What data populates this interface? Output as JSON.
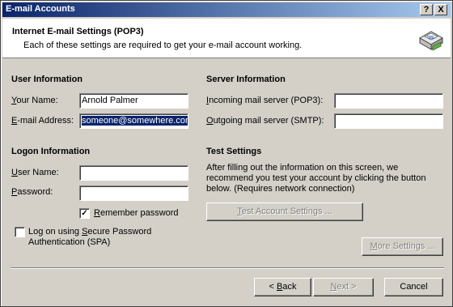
{
  "window": {
    "title": "E-mail Accounts",
    "help_label": "?",
    "close_label": "X"
  },
  "header": {
    "title": "Internet E-mail Settings (POP3)",
    "subtitle": "Each of these settings are required to get your e-mail account working."
  },
  "user_info": {
    "heading": "User Information",
    "name_label_u": "Y",
    "name_label_rest": "our Name:",
    "name_value": "Arnold Palmer",
    "email_label_u": "E",
    "email_label_rest": "-mail Address:",
    "email_value": "someone@somewhere.com"
  },
  "server_info": {
    "heading": "Server Information",
    "incoming_label_u": "I",
    "incoming_label_rest": "ncoming mail server (POP3):",
    "incoming_value": "",
    "outgoing_label_u": "O",
    "outgoing_label_rest": "utgoing mail server (SMTP):",
    "outgoing_value": ""
  },
  "logon_info": {
    "heading": "Logon Information",
    "username_label_u": "U",
    "username_label_rest": "ser Name:",
    "username_value": "",
    "password_label_u": "P",
    "password_label_rest": "assword:",
    "password_value": "",
    "remember_label_u": "R",
    "remember_label_rest": "emember password",
    "remember_checked": true,
    "spa_label_pre": "Log on using ",
    "spa_label_u": "S",
    "spa_label_rest": "ecure Password",
    "spa_label_line2": "Authentication (SPA)",
    "spa_checked": false
  },
  "test_settings": {
    "heading": "Test Settings",
    "line1": "After filling out the information on this screen, we",
    "line2": "recommend you test your account by clicking the button",
    "line3": "below. (Requires network connection)",
    "button_label_u": "T",
    "button_label_rest": "est Account Settings ..."
  },
  "more_settings": {
    "label_u": "M",
    "label_rest": "ore Settings ..."
  },
  "footer": {
    "back_lt": "< ",
    "back_u": "B",
    "back_rest": "ack",
    "next_u": "N",
    "next_rest": "ext >",
    "cancel_label": "Cancel"
  },
  "check_glyph": "✓"
}
